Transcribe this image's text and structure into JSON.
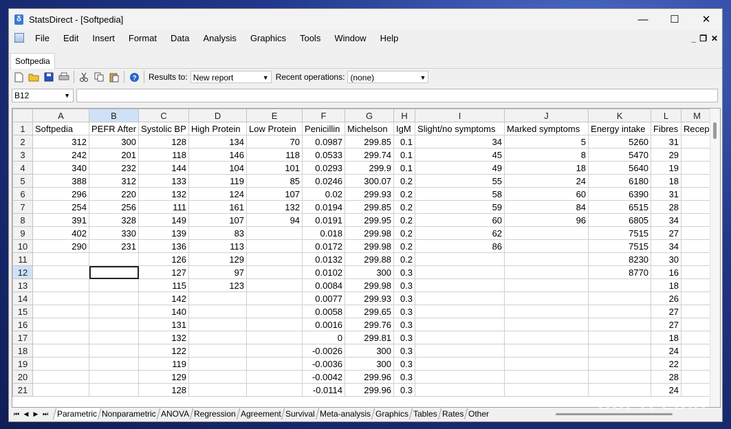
{
  "window": {
    "title": "StatsDirect - [Softpedia]"
  },
  "menu": [
    "File",
    "Edit",
    "Insert",
    "Format",
    "Data",
    "Analysis",
    "Graphics",
    "Tools",
    "Window",
    "Help"
  ],
  "doc_tab": "Softpedia",
  "toolbar": {
    "results_label": "Results to:",
    "results_value": "New report",
    "recent_label": "Recent operations:",
    "recent_value": "(none)"
  },
  "formula_bar": {
    "cell_ref": "B12",
    "content": ""
  },
  "sheet": {
    "columns": [
      "A",
      "B",
      "C",
      "D",
      "E",
      "F",
      "G",
      "H",
      "I",
      "J",
      "K",
      "L",
      "M"
    ],
    "selected_column": "B",
    "selected_row": "12",
    "rows": [
      {
        "n": "1",
        "cells": [
          "Softpedia",
          "PEFR After",
          "Systolic BP",
          "High Protein",
          "Low Protein",
          "Penicillin",
          "Michelson",
          "IgM",
          "Slight/no symptoms",
          "Marked symptoms",
          "Energy intake",
          "Fibres",
          "Recep"
        ]
      },
      {
        "n": "2",
        "cells": [
          "312",
          "300",
          "128",
          "134",
          "70",
          "0.0987",
          "299.85",
          "0.1",
          "34",
          "5",
          "5260",
          "31",
          ""
        ]
      },
      {
        "n": "3",
        "cells": [
          "242",
          "201",
          "118",
          "146",
          "118",
          "0.0533",
          "299.74",
          "0.1",
          "45",
          "8",
          "5470",
          "29",
          ""
        ]
      },
      {
        "n": "4",
        "cells": [
          "340",
          "232",
          "144",
          "104",
          "101",
          "0.0293",
          "299.9",
          "0.1",
          "49",
          "18",
          "5640",
          "19",
          ""
        ]
      },
      {
        "n": "5",
        "cells": [
          "388",
          "312",
          "133",
          "119",
          "85",
          "0.0246",
          "300.07",
          "0.2",
          "55",
          "24",
          "6180",
          "18",
          ""
        ]
      },
      {
        "n": "6",
        "cells": [
          "296",
          "220",
          "132",
          "124",
          "107",
          "0.02",
          "299.93",
          "0.2",
          "58",
          "60",
          "6390",
          "31",
          ""
        ]
      },
      {
        "n": "7",
        "cells": [
          "254",
          "256",
          "111",
          "161",
          "132",
          "0.0194",
          "299.85",
          "0.2",
          "59",
          "84",
          "6515",
          "28",
          ""
        ]
      },
      {
        "n": "8",
        "cells": [
          "391",
          "328",
          "149",
          "107",
          "94",
          "0.0191",
          "299.95",
          "0.2",
          "60",
          "96",
          "6805",
          "34",
          ""
        ]
      },
      {
        "n": "9",
        "cells": [
          "402",
          "330",
          "139",
          "83",
          "",
          "0.018",
          "299.98",
          "0.2",
          "62",
          "",
          "7515",
          "27",
          ""
        ]
      },
      {
        "n": "10",
        "cells": [
          "290",
          "231",
          "136",
          "113",
          "",
          "0.0172",
          "299.98",
          "0.2",
          "86",
          "",
          "7515",
          "34",
          ""
        ]
      },
      {
        "n": "11",
        "cells": [
          "",
          "",
          "126",
          "129",
          "",
          "0.0132",
          "299.88",
          "0.2",
          "",
          "",
          "8230",
          "30",
          ""
        ]
      },
      {
        "n": "12",
        "cells": [
          "",
          "",
          "127",
          "97",
          "",
          "0.0102",
          "300",
          "0.3",
          "",
          "",
          "8770",
          "16",
          ""
        ]
      },
      {
        "n": "13",
        "cells": [
          "",
          "",
          "115",
          "123",
          "",
          "0.0084",
          "299.98",
          "0.3",
          "",
          "",
          "",
          "18",
          ""
        ]
      },
      {
        "n": "14",
        "cells": [
          "",
          "",
          "142",
          "",
          "",
          "0.0077",
          "299.93",
          "0.3",
          "",
          "",
          "",
          "26",
          ""
        ]
      },
      {
        "n": "15",
        "cells": [
          "",
          "",
          "140",
          "",
          "",
          "0.0058",
          "299.65",
          "0.3",
          "",
          "",
          "",
          "27",
          ""
        ]
      },
      {
        "n": "16",
        "cells": [
          "",
          "",
          "131",
          "",
          "",
          "0.0016",
          "299.76",
          "0.3",
          "",
          "",
          "",
          "27",
          ""
        ]
      },
      {
        "n": "17",
        "cells": [
          "",
          "",
          "132",
          "",
          "",
          "0",
          "299.81",
          "0.3",
          "",
          "",
          "",
          "18",
          ""
        ]
      },
      {
        "n": "18",
        "cells": [
          "",
          "",
          "122",
          "",
          "",
          "-0.0026",
          "300",
          "0.3",
          "",
          "",
          "",
          "24",
          ""
        ]
      },
      {
        "n": "19",
        "cells": [
          "",
          "",
          "119",
          "",
          "",
          "-0.0036",
          "300",
          "0.3",
          "",
          "",
          "",
          "22",
          ""
        ]
      },
      {
        "n": "20",
        "cells": [
          "",
          "",
          "129",
          "",
          "",
          "-0.0042",
          "299.96",
          "0.3",
          "",
          "",
          "",
          "28",
          ""
        ]
      },
      {
        "n": "21",
        "cells": [
          "",
          "",
          "128",
          "",
          "",
          "-0.0114",
          "299.96",
          "0.3",
          "",
          "",
          "",
          "24",
          ""
        ]
      }
    ]
  },
  "sheet_tabs": [
    "Parametric",
    "Nonparametric",
    "ANOVA",
    "Regression",
    "Agreement",
    "Survival",
    "Meta-analysis",
    "Graphics",
    "Tables",
    "Rates",
    "Other"
  ],
  "active_sheet_tab": "Parametric",
  "watermark": "SOFTPEDIA"
}
